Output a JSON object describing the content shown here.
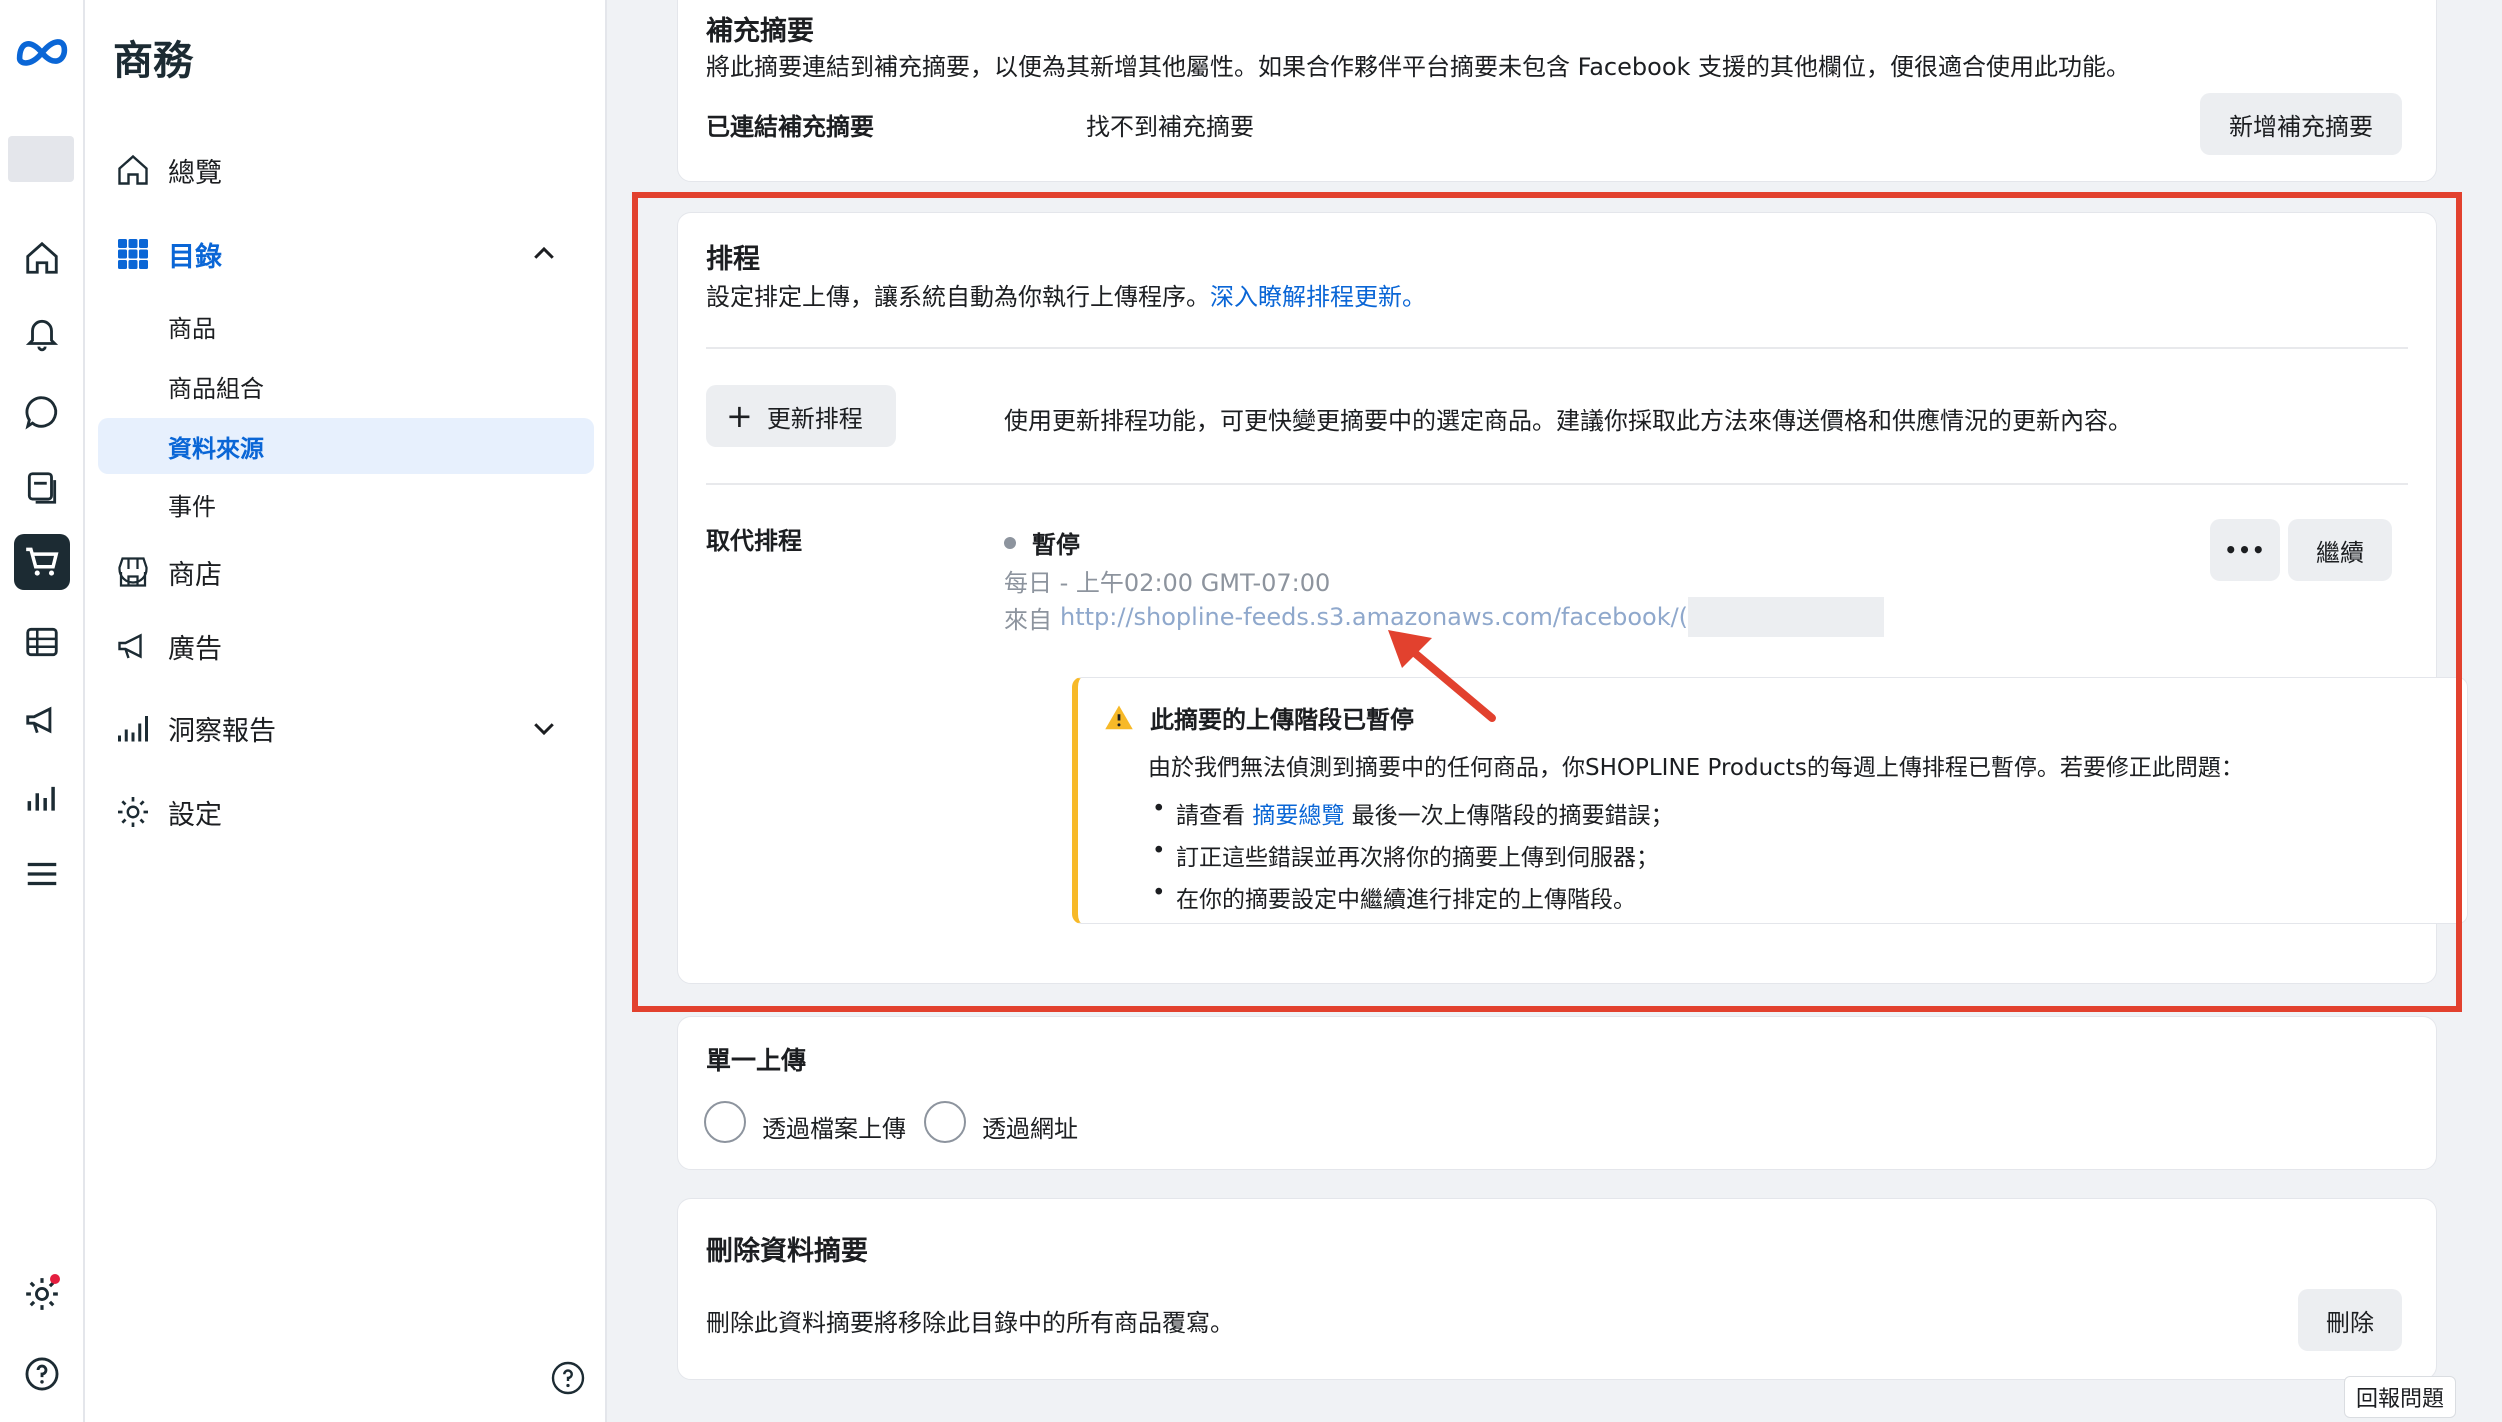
{
  "sidebar": {
    "title": "商務",
    "overview": "總覽",
    "catalog": "目錄",
    "catalog_items": [
      "商品",
      "商品組合",
      "資料來源",
      "事件"
    ],
    "shop": "商店",
    "ads": "廣告",
    "insights": "洞察報告",
    "settings": "設定"
  },
  "supplement": {
    "title": "補充摘要",
    "description": "將此摘要連結到補充摘要，以便為其新增其他屬性。如果合作夥伴平台摘要未包含 Facebook 支援的其他欄位，便很適合使用此功能。",
    "linked_label": "已連結補充摘要",
    "linked_value": "找不到補充摘要",
    "add_button": "新增補充摘要"
  },
  "schedule": {
    "title": "排程",
    "description": "設定排定上傳，讓系統自動為你執行上傳程序。",
    "learn_more": "深入瞭解排程更新。",
    "update_button": "更新排程",
    "update_description": "使用更新排程功能，可更快變更摘要中的選定商品。建議你採取此方法來傳送價格和供應情況的更新內容。",
    "replace_label": "取代排程",
    "status": "暫停",
    "frequency": "每日 - 上午02:00 GMT-07:00",
    "source_prefix": "來自",
    "source_url": "http://shopline-feeds.s3.amazonaws.com/facebook/(",
    "more_button": "•••",
    "resume_button": "繼續",
    "warning": {
      "title": "此摘要的上傳階段已暫停",
      "message": "由於我們無法偵測到摘要中的任何商品，你SHOPLINE Products的每週上傳排程已暫停。若要修正此問題：",
      "bullet1_prefix": "請查看",
      "bullet1_link": "摘要總覽",
      "bullet1_suffix": "最後一次上傳階段的摘要錯誤；",
      "bullet2": "訂正這些錯誤並再次將你的摘要上傳到伺服器；",
      "bullet3": "在你的摘要設定中繼續進行排定的上傳階段。"
    }
  },
  "single_upload": {
    "title": "單一上傳",
    "option_file": "透過檔案上傳",
    "option_url": "透過網址"
  },
  "delete_feed": {
    "title": "刪除資料摘要",
    "description": "刪除此資料摘要將移除此目錄中的所有商品覆寫。",
    "button": "刪除"
  },
  "report_problem": "回報問題",
  "colors": {
    "accent": "#0a66d6",
    "highlight": "#e2412e",
    "warning": "#f7b928"
  }
}
